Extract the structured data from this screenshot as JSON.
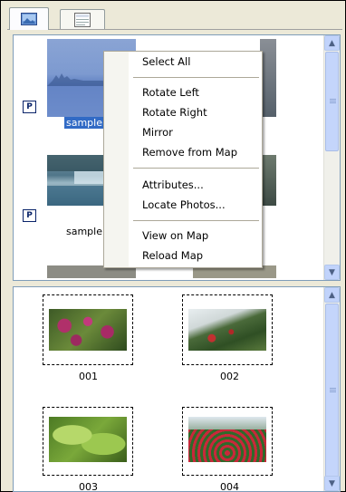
{
  "tabs": [
    {
      "name": "photos-tab",
      "icon": "landscape-icon"
    },
    {
      "name": "list-tab",
      "icon": "list-document-icon"
    }
  ],
  "top_pane": {
    "items": [
      {
        "label": "sample",
        "selected": true,
        "badge": "P"
      },
      {
        "label": "sample",
        "selected": false,
        "badge": "P"
      }
    ]
  },
  "context_menu": {
    "items": [
      {
        "label": "Select All"
      },
      {
        "label": "Rotate Left"
      },
      {
        "label": "Rotate Right"
      },
      {
        "label": "Mirror"
      },
      {
        "label": "Remove from Map"
      },
      {
        "label": "Attributes..."
      },
      {
        "label": "Locate Photos..."
      },
      {
        "label": "View on Map"
      },
      {
        "label": "Reload Map"
      }
    ]
  },
  "bottom_pane": {
    "items": [
      {
        "label": "001"
      },
      {
        "label": "002"
      },
      {
        "label": "003"
      },
      {
        "label": "004"
      }
    ]
  },
  "colors": {
    "selection": "#316ac5",
    "scrollbar": "#c1d3fb",
    "menu_border": "#aca899"
  }
}
